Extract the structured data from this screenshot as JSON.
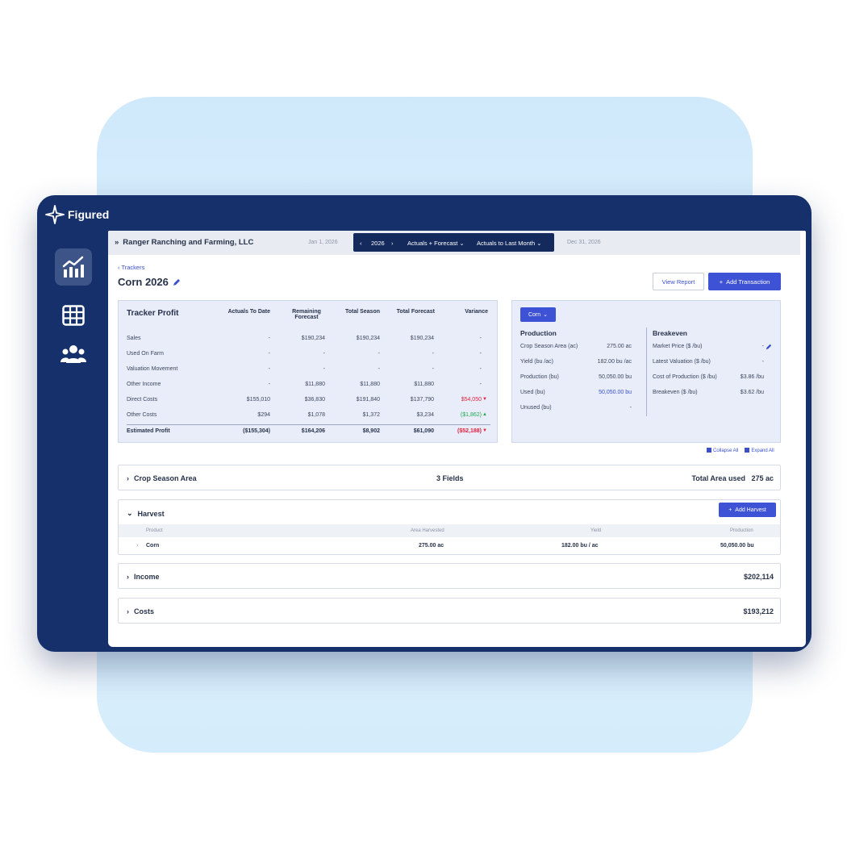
{
  "app": {
    "logo_text": "Figured"
  },
  "sidebar": {
    "items": [
      {
        "name": "analytics",
        "icon": "chart-icon",
        "active": true
      },
      {
        "name": "grid",
        "icon": "table-icon",
        "active": false
      },
      {
        "name": "team",
        "icon": "users-icon",
        "active": false
      }
    ]
  },
  "topbar": {
    "org_name": "Ranger Ranching and Farming, LLC",
    "start_date": "Jan 1, 2026",
    "year": "2026",
    "view_mode": "Actuals + Forecast",
    "actuals_to": "Actuals to Last Month",
    "end_date": "Dec 31, 2026"
  },
  "page": {
    "back_label": "Trackers",
    "title": "Corn 2026",
    "view_report_label": "View Report",
    "add_transaction_label": "Add Transaction"
  },
  "profit": {
    "title": "Tracker Profit",
    "headers": [
      "Actuals To Date",
      "Remaining Forecast",
      "Total Season",
      "Total Forecast",
      "Variance"
    ],
    "rows": [
      {
        "label": "Sales",
        "cells": [
          "-",
          "$190,234",
          "$190,234",
          "$190,234",
          "-"
        ]
      },
      {
        "label": "Used On Farm",
        "cells": [
          "-",
          "-",
          "-",
          "-",
          "-"
        ]
      },
      {
        "label": "Valuation Movement",
        "cells": [
          "-",
          "-",
          "-",
          "-",
          "-"
        ]
      },
      {
        "label": "Other Income",
        "cells": [
          "-",
          "$11,880",
          "$11,880",
          "$11,880",
          "-"
        ]
      },
      {
        "label": "Direct Costs",
        "cells": [
          "$155,010",
          "$36,830",
          "$191,840",
          "$137,790",
          "$54,050"
        ]
      },
      {
        "label": "Other Costs",
        "cells": [
          "$294",
          "$1,078",
          "$1,372",
          "$3,234",
          "($1,862)"
        ]
      },
      {
        "label": "Estimated Profit",
        "cells": [
          "($155,304)",
          "$164,206",
          "$8,902",
          "$61,090",
          "($52,188)"
        ]
      }
    ]
  },
  "summary": {
    "crop_select": "Corn",
    "production_title": "Production",
    "production": [
      {
        "label": "Crop Season Area (ac)",
        "value": "275.00 ac"
      },
      {
        "label": "Yield (bu /ac)",
        "value": "182.00 bu /ac"
      },
      {
        "label": "Production (bu)",
        "value": "50,050.00 bu"
      },
      {
        "label": "Used (bu)",
        "value": "50,050.00 bu"
      },
      {
        "label": "Unused (bu)",
        "value": "-"
      }
    ],
    "breakeven_title": "Breakeven",
    "breakeven": [
      {
        "label": "Market Price ($ /bu)",
        "value": "-"
      },
      {
        "label": "Latest Valuation ($ /bu)",
        "value": "-"
      },
      {
        "label": "Cost of Production ($ /bu)",
        "value": "$3.86 /bu"
      },
      {
        "label": "Breakeven ($ /bu)",
        "value": "$3.62 /bu"
      }
    ]
  },
  "controls": {
    "collapse_all": "Collapse All",
    "expand_all": "Expand All"
  },
  "sections": {
    "crop_area": {
      "label": "Crop Season Area",
      "fields": "3 Fields",
      "total_label": "Total Area used",
      "total_value": "275 ac"
    },
    "harvest": {
      "label": "Harvest",
      "add_label": "Add Harvest",
      "columns": [
        "Product",
        "Area Harvested",
        "Yield",
        "Production"
      ],
      "rows": [
        {
          "product": "Corn",
          "area": "275.00 ac",
          "yield": "182.00 bu / ac",
          "production": "50,050.00 bu"
        }
      ]
    },
    "income": {
      "label": "Income",
      "value": "$202,114"
    },
    "costs": {
      "label": "Costs",
      "value": "$193,212"
    }
  },
  "colors": {
    "navy": "#16306b",
    "accent": "#3d52d5",
    "negative": "#e0203c",
    "positive": "#1fa84f"
  }
}
